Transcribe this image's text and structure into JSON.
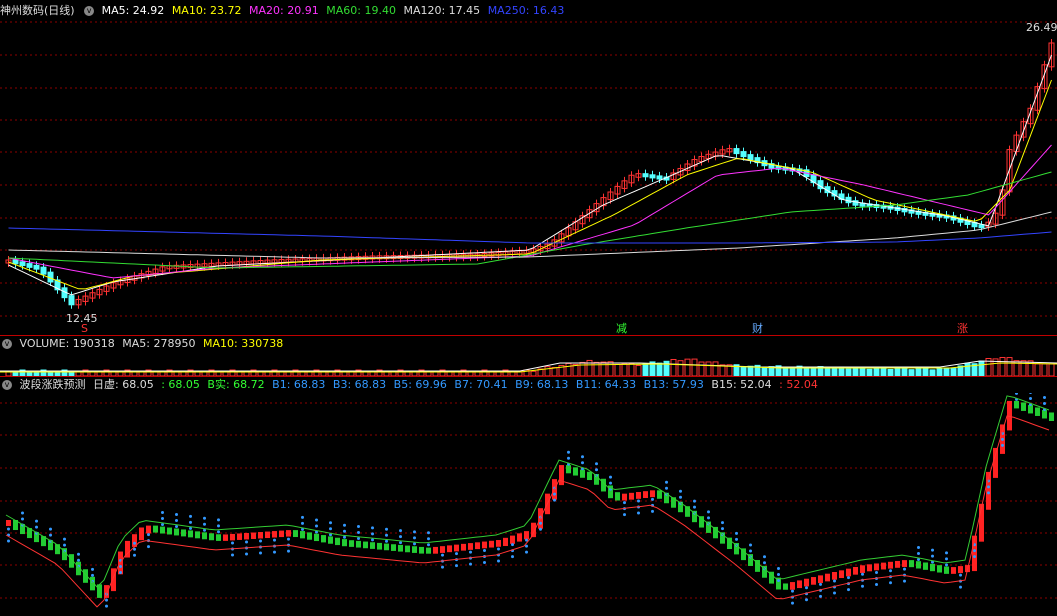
{
  "main": {
    "title": "神州数码(日线)",
    "ma": [
      {
        "label": "MA5: 24.92",
        "color": "#ffffff"
      },
      {
        "label": "MA10: 23.72",
        "color": "#ffff00"
      },
      {
        "label": "MA20: 20.91",
        "color": "#ff33ff"
      },
      {
        "label": "MA60: 19.40",
        "color": "#33dd33"
      },
      {
        "label": "MA120: 17.45",
        "color": "#dddddd"
      },
      {
        "label": "MA250: 16.43",
        "color": "#3344ff"
      }
    ],
    "high_label": "26.49",
    "low_label": "12.45",
    "markers": [
      {
        "text": "S",
        "color": "#ff3333"
      },
      {
        "text": "减",
        "color": "#33ff33"
      },
      {
        "text": "财",
        "color": "#66aaff"
      },
      {
        "text": "涨",
        "color": "#ff3333"
      }
    ]
  },
  "volume": {
    "label": "VOLUME: 190318",
    "ma5": "MA5: 278950",
    "ma10": "MA10: 330738",
    "colors": {
      "label": "#dddddd",
      "ma5": "#dddddd",
      "ma10": "#ffff00"
    }
  },
  "indicator": {
    "name": "波段涨跌预测",
    "items": [
      {
        "text": "日虚: 68.05",
        "color": "#dddddd"
      },
      {
        "text": ": 68.05",
        "color": "#33ff33"
      },
      {
        "text": "B实: 68.72",
        "color": "#33ff33"
      },
      {
        "text": "B1: 68.83",
        "color": "#3399ff"
      },
      {
        "text": "B3: 68.83",
        "color": "#3399ff"
      },
      {
        "text": "B5: 69.96",
        "color": "#3399ff"
      },
      {
        "text": "B7: 70.41",
        "color": "#3399ff"
      },
      {
        "text": "B9: 68.13",
        "color": "#3399ff"
      },
      {
        "text": "B11: 64.33",
        "color": "#3399ff"
      },
      {
        "text": "B13: 57.93",
        "color": "#3399ff"
      },
      {
        "text": "B15: 52.04",
        "color": "#dddddd"
      },
      {
        "text": ": 52.04",
        "color": "#ff3333"
      }
    ]
  },
  "colors": {
    "up": "#ff3333",
    "down": "#54ffff",
    "grid": "#8b0000",
    "ma5": "#ffffff",
    "ma10": "#ffff00",
    "ma20": "#ff33ff",
    "ma60": "#33dd33",
    "ma120": "#dddddd",
    "ma250": "#3344ff",
    "ind_up": "#ff2222",
    "ind_down": "#22cc33",
    "dots": "#3399ff"
  }
}
